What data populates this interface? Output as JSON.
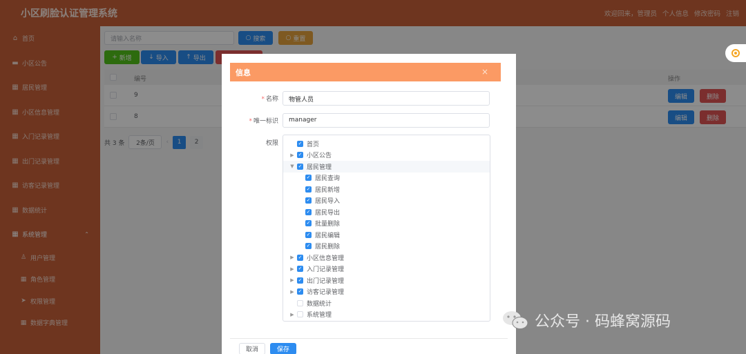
{
  "header": {
    "app_title": "小区刷脸认证管理系统",
    "welcome": "欢迎回来，管理员",
    "profile": "个人信息",
    "change_password": "修改密码",
    "logout": "注销"
  },
  "sidebar": {
    "items": [
      {
        "label": "首页",
        "icon": "home-icon"
      },
      {
        "label": "小区公告",
        "icon": "message-icon"
      },
      {
        "label": "居民管理",
        "icon": "grid-icon"
      },
      {
        "label": "小区信息管理",
        "icon": "grid-icon"
      },
      {
        "label": "入门记录管理",
        "icon": "grid-icon"
      },
      {
        "label": "出门记录管理",
        "icon": "grid-icon"
      },
      {
        "label": "访客记录管理",
        "icon": "grid-icon"
      },
      {
        "label": "数据统计",
        "icon": "grid-icon"
      },
      {
        "label": "系统管理",
        "icon": "grid-icon"
      }
    ],
    "sub_items": [
      {
        "label": "用户管理",
        "icon": "user-icon"
      },
      {
        "label": "角色管理",
        "icon": "grid-icon"
      },
      {
        "label": "权限管理",
        "icon": "send-icon"
      },
      {
        "label": "数据字典管理",
        "icon": "grid-icon"
      }
    ]
  },
  "toolbar": {
    "search_placeholder": "请输入名称",
    "search_label": "搜索",
    "reset_label": "重置",
    "add_label": "新增",
    "import_label": "导入",
    "export_label": "导出"
  },
  "table": {
    "col_id": "编号",
    "col_action": "操作",
    "rows": [
      {
        "id": "9",
        "edit": "编辑",
        "delete": "删除"
      },
      {
        "id": "8",
        "edit": "编辑",
        "delete": "删除"
      }
    ]
  },
  "pagination": {
    "total": "共 3 条",
    "page_size": "2条/页",
    "pages": [
      "1",
      "2"
    ],
    "current": "1"
  },
  "dialog": {
    "title": "信息",
    "name_label": "名称",
    "name_value": "物管人员",
    "key_label": "唯一标识",
    "key_value": "manager",
    "perm_label": "权限",
    "tree": [
      {
        "label": "首页",
        "checked": true,
        "arrow": ""
      },
      {
        "label": "小区公告",
        "checked": true,
        "arrow": "right"
      },
      {
        "label": "居民管理",
        "checked": true,
        "arrow": "down"
      },
      {
        "label": "居民查询",
        "checked": true,
        "child": true
      },
      {
        "label": "居民新增",
        "checked": true,
        "child": true
      },
      {
        "label": "居民导入",
        "checked": true,
        "child": true
      },
      {
        "label": "居民导出",
        "checked": true,
        "child": true
      },
      {
        "label": "批量删除",
        "checked": true,
        "child": true
      },
      {
        "label": "居民编辑",
        "checked": true,
        "child": true
      },
      {
        "label": "居民删除",
        "checked": true,
        "child": true
      },
      {
        "label": "小区信息管理",
        "checked": true,
        "arrow": "right"
      },
      {
        "label": "入门记录管理",
        "checked": true,
        "arrow": "right"
      },
      {
        "label": "出门记录管理",
        "checked": true,
        "arrow": "right"
      },
      {
        "label": "访客记录管理",
        "checked": true,
        "arrow": "right"
      },
      {
        "label": "数据统计",
        "checked": false,
        "arrow": ""
      },
      {
        "label": "系统管理",
        "checked": false,
        "arrow": "right"
      }
    ],
    "cancel_label": "取消",
    "save_label": "保存"
  },
  "watermark": {
    "text": "公众号 · 码蜂窝源码"
  },
  "colors": {
    "sidebar": "#c8623a",
    "dialog_header": "#fb9a64",
    "primary": "#2d8cf0",
    "danger": "#e05555"
  }
}
